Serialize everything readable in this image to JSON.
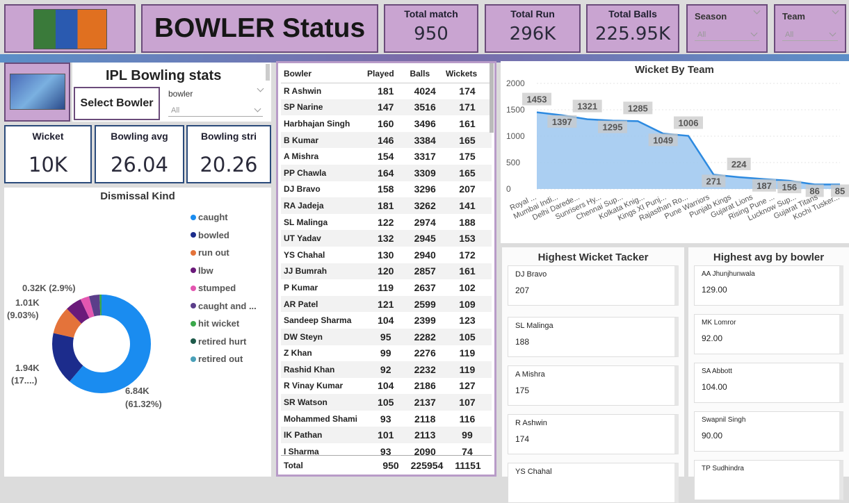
{
  "header": {
    "title": "BOWLER Status",
    "kpis": [
      {
        "label": "Total match",
        "value": "950"
      },
      {
        "label": "Total Run",
        "value": "296K"
      },
      {
        "label": "Total Balls",
        "value": "225.95K"
      }
    ],
    "season": {
      "label": "Season",
      "value": "All"
    },
    "team": {
      "label": "Team",
      "value": "All"
    }
  },
  "ipl": {
    "title": "IPL Bowling stats",
    "select_label": "Select Bowler",
    "bowler_label": "bowler",
    "bowler_value": "All"
  },
  "stats": [
    {
      "label": "Wicket",
      "value": "10K"
    },
    {
      "label": "Bowling avg",
      "value": "26.04"
    },
    {
      "label": "Bowling stri",
      "value": "20.26"
    }
  ],
  "dismissal": {
    "title": "Dismissal Kind",
    "legend": [
      {
        "label": "caught",
        "color": "#1a8cf0"
      },
      {
        "label": "bowled",
        "color": "#1c2c8c"
      },
      {
        "label": "run out",
        "color": "#e4733a"
      },
      {
        "label": "lbw",
        "color": "#6b1a7a"
      },
      {
        "label": "stumped",
        "color": "#e356b0"
      },
      {
        "label": "caught and ...",
        "color": "#5b3e8a"
      },
      {
        "label": "hit wicket",
        "color": "#3aa84a"
      },
      {
        "label": "retired hurt",
        "color": "#1e5a4a"
      },
      {
        "label": "retired out",
        "color": "#4aa0b8"
      }
    ],
    "labels": {
      "l1": "0.32K (2.9%)",
      "l2a": "1.01K",
      "l2b": "(9.03%)",
      "l3a": "1.94K",
      "l3b": "(17....)",
      "l4a": "6.84K",
      "l4b": "(61.32%)"
    }
  },
  "table": {
    "headers": [
      "Bowler",
      "Played",
      "Balls",
      "Wickets"
    ],
    "rows": [
      [
        "R Ashwin",
        "181",
        "4024",
        "174"
      ],
      [
        "SP Narine",
        "147",
        "3516",
        "171"
      ],
      [
        "Harbhajan Singh",
        "160",
        "3496",
        "161"
      ],
      [
        "B Kumar",
        "146",
        "3384",
        "165"
      ],
      [
        "A Mishra",
        "154",
        "3317",
        "175"
      ],
      [
        "PP Chawla",
        "164",
        "3309",
        "165"
      ],
      [
        "DJ Bravo",
        "158",
        "3296",
        "207"
      ],
      [
        "RA Jadeja",
        "181",
        "3262",
        "141"
      ],
      [
        "SL Malinga",
        "122",
        "2974",
        "188"
      ],
      [
        "UT Yadav",
        "132",
        "2945",
        "153"
      ],
      [
        "YS Chahal",
        "130",
        "2940",
        "172"
      ],
      [
        "JJ Bumrah",
        "120",
        "2857",
        "161"
      ],
      [
        "P Kumar",
        "119",
        "2637",
        "102"
      ],
      [
        "AR Patel",
        "121",
        "2599",
        "109"
      ],
      [
        "Sandeep Sharma",
        "104",
        "2399",
        "123"
      ],
      [
        "DW Steyn",
        "95",
        "2282",
        "105"
      ],
      [
        "Z Khan",
        "99",
        "2276",
        "119"
      ],
      [
        "Rashid Khan",
        "92",
        "2232",
        "119"
      ],
      [
        "R Vinay Kumar",
        "104",
        "2186",
        "127"
      ],
      [
        "SR Watson",
        "105",
        "2137",
        "107"
      ],
      [
        "Mohammed Shami",
        "93",
        "2118",
        "116"
      ],
      [
        "IK Pathan",
        "101",
        "2113",
        "99"
      ],
      [
        "I Sharma",
        "93",
        "2090",
        "74"
      ]
    ],
    "total": [
      "Total",
      "950",
      "225954",
      "11151"
    ]
  },
  "chart_data": {
    "type": "area",
    "title": "Wicket By Team",
    "categories": [
      "Royal ...",
      "Mumbai Indi...",
      "Delhi Darede...",
      "Sunrisers Hy...",
      "Chennai Sup...",
      "Kolkata Knig...",
      "Kings XI Punj...",
      "Rajasthan Ro...",
      "Pune Warriors",
      "Punjab Kings",
      "Gujarat Lions",
      "Rising Pune ...",
      "Lucknow Sup...",
      "Gujarat Titans",
      "Kochi Tusker..."
    ],
    "values": [
      1453,
      1397,
      1321,
      1295,
      1285,
      1049,
      1006,
      271,
      224,
      187,
      156,
      86,
      85
    ],
    "yticks": [
      "0",
      "500",
      "1000",
      "1500",
      "2000"
    ],
    "ylim": [
      0,
      2000
    ],
    "color": "#2d8ae0"
  },
  "highest_wicket": {
    "title": "Highest Wicket Tacker",
    "items": [
      {
        "name": "DJ Bravo",
        "value": "207"
      },
      {
        "name": "SL Malinga",
        "value": "188"
      },
      {
        "name": "A Mishra",
        "value": "175"
      },
      {
        "name": "R Ashwin",
        "value": "174"
      },
      {
        "name": "YS Chahal",
        "value": ""
      }
    ]
  },
  "highest_avg": {
    "title": "Highest avg by bowler",
    "items": [
      {
        "name": "AA Jhunjhunwala",
        "value": "129.00"
      },
      {
        "name": "MK Lomror",
        "value": "92.00"
      },
      {
        "name": "SA Abbott",
        "value": "104.00"
      },
      {
        "name": "Swapnil Singh",
        "value": "90.00"
      },
      {
        "name": "TP Sudhindra",
        "value": ""
      }
    ]
  }
}
